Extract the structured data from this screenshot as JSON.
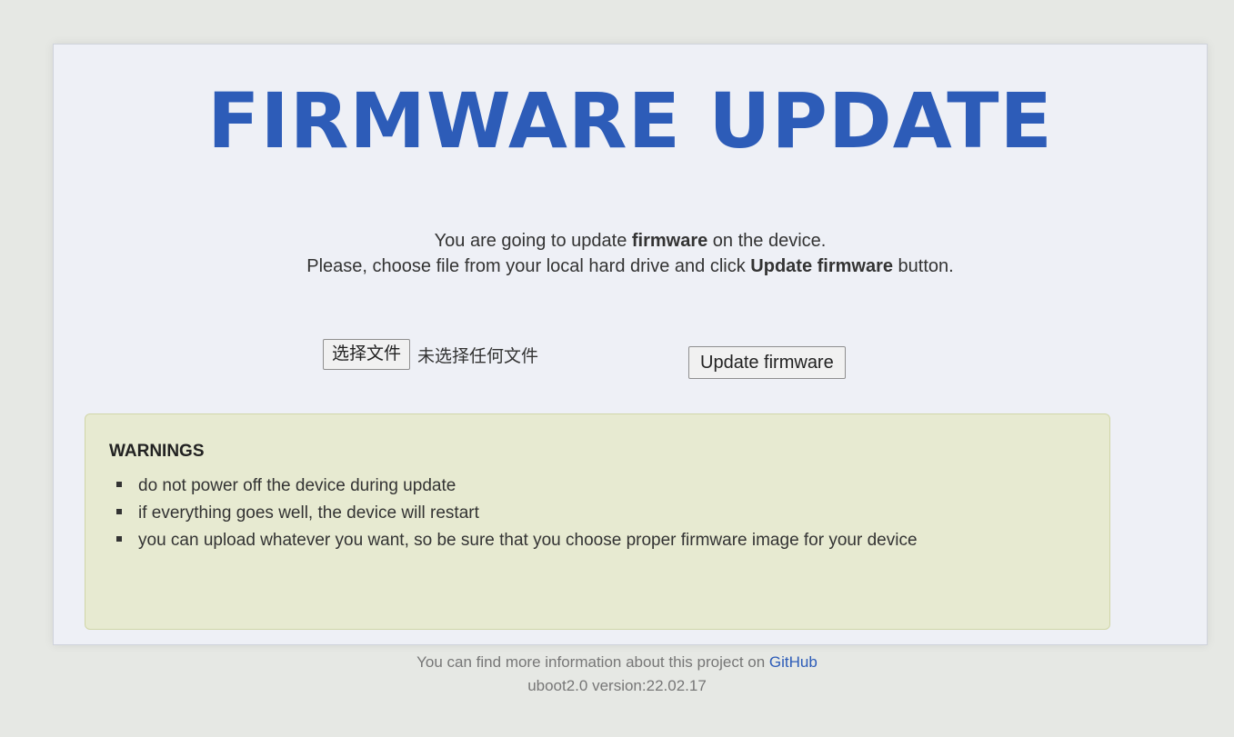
{
  "header": {
    "title": "FIRMWARE UPDATE"
  },
  "intro": {
    "line1_prefix": "You are going to update ",
    "line1_bold": "firmware",
    "line1_suffix": " on the device.",
    "line2_prefix": "Please, choose file from your local hard drive and click ",
    "line2_bold": "Update firmware",
    "line2_suffix": " button."
  },
  "form": {
    "choose_file_label": "选择文件",
    "file_status": "未选择任何文件",
    "update_button_label": "Update firmware"
  },
  "warnings": {
    "title": "WARNINGS",
    "items": [
      "do not power off the device during update",
      "if everything goes well, the device will restart",
      "you can upload whatever you want, so be sure that you choose proper firmware image for your device"
    ]
  },
  "footer": {
    "info_prefix": "You can find more information about this project on ",
    "github_link": "GitHub",
    "version": "uboot2.0 version:22.02.17"
  },
  "colors": {
    "title": "#2d5cb8",
    "link": "#2d5cb8",
    "warnings_bg": "#e7ead1"
  }
}
